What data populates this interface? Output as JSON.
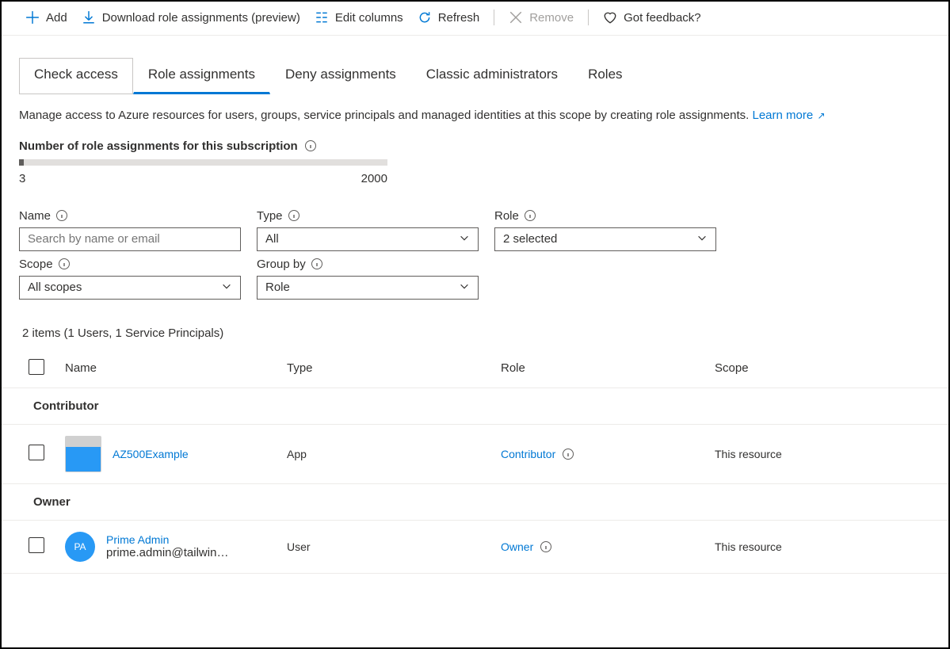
{
  "toolbar": {
    "add": "Add",
    "download": "Download role assignments (preview)",
    "edit_columns": "Edit columns",
    "refresh": "Refresh",
    "remove": "Remove",
    "feedback": "Got feedback?"
  },
  "tabs": {
    "check_access": "Check access",
    "role_assignments": "Role assignments",
    "deny_assignments": "Deny assignments",
    "classic_admins": "Classic administrators",
    "roles": "Roles"
  },
  "description": {
    "text": "Manage access to Azure resources for users, groups, service principals and managed identities at this scope by creating role assignments. ",
    "learn_more": "Learn more"
  },
  "stats": {
    "label": "Number of role assignments for this subscription",
    "current": "3",
    "max": "2000"
  },
  "filters": {
    "name_label": "Name",
    "name_placeholder": "Search by name or email",
    "type_label": "Type",
    "type_value": "All",
    "role_label": "Role",
    "role_value": "2 selected",
    "scope_label": "Scope",
    "scope_value": "All scopes",
    "groupby_label": "Group by",
    "groupby_value": "Role"
  },
  "summary": "2 items (1 Users, 1 Service Principals)",
  "columns": {
    "name": "Name",
    "type": "Type",
    "role": "Role",
    "scope": "Scope"
  },
  "groups": [
    {
      "title": "Contributor",
      "rows": [
        {
          "avatar_type": "app",
          "initials": "",
          "name": "AZ500Example",
          "email": "",
          "type": "App",
          "role": "Contributor",
          "scope": "This resource"
        }
      ]
    },
    {
      "title": "Owner",
      "rows": [
        {
          "avatar_type": "user",
          "initials": "PA",
          "name": "Prime Admin",
          "email": "prime.admin@tailwin…",
          "type": "User",
          "role": "Owner",
          "scope": "This resource"
        }
      ]
    }
  ]
}
